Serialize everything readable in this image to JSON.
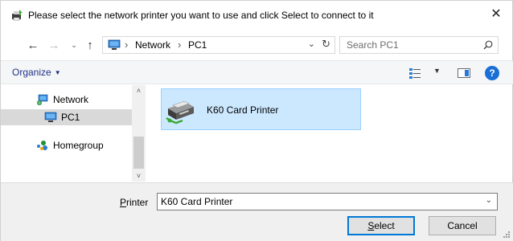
{
  "window": {
    "title": "Please select the network printer you want to use and click Select to connect to it",
    "close_glyph": "✕"
  },
  "nav": {
    "back_glyph": "←",
    "forward_glyph": "→",
    "recent_glyph": "⌄",
    "up_glyph": "↑",
    "address": {
      "segments": [
        "Network",
        "PC1"
      ],
      "separator": "›",
      "dropdown_glyph": "⌄",
      "refresh_glyph": "↻"
    },
    "search": {
      "placeholder": "Search PC1"
    }
  },
  "commandbar": {
    "organize_label": "Organize",
    "organize_caret": "▼",
    "view_caret": "▼",
    "help_label": "?"
  },
  "navpane": {
    "items": [
      {
        "label": "Network",
        "icon": "network-icon",
        "selected": false
      },
      {
        "label": "PC1",
        "icon": "computer-icon",
        "selected": true
      },
      {
        "label": "Homegroup",
        "icon": "homegroup-icon",
        "selected": false
      }
    ],
    "scroll_up_glyph": "˄",
    "scroll_down_glyph": "˅"
  },
  "content": {
    "items": [
      {
        "label": "K60 Card Printer",
        "icon": "printer-icon",
        "selected": true
      }
    ]
  },
  "footer": {
    "printer_label_accel": "P",
    "printer_label_rest": "rinter",
    "printer_value": "K60 Card Printer",
    "combo_arrow": "⌄",
    "select_accel": "S",
    "select_rest": "elect",
    "cancel_label": "Cancel"
  },
  "colors": {
    "selection_bg": "#cce8ff",
    "selection_border": "#99d1ff",
    "accent": "#0078d7",
    "help_blue": "#1a6fd6",
    "link_blue": "#1e3287"
  }
}
